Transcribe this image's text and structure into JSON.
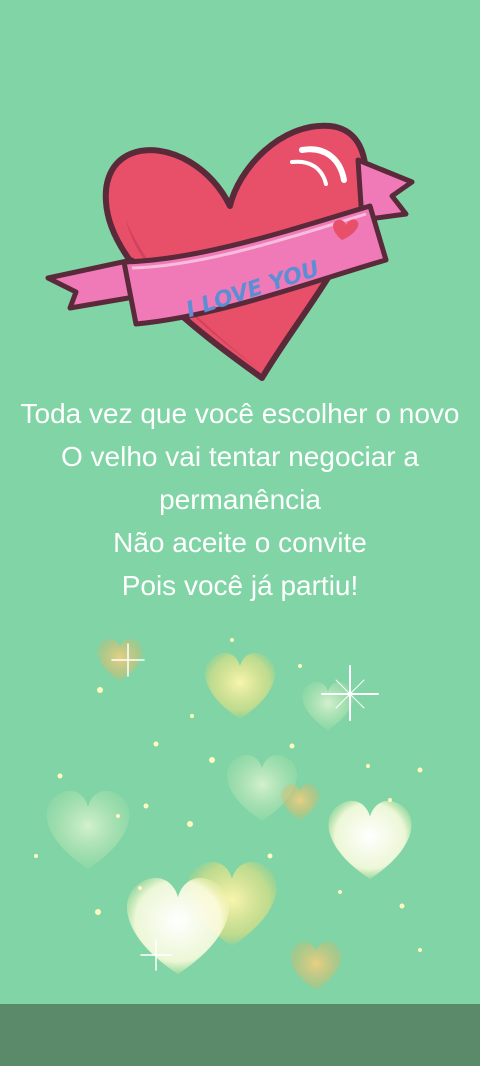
{
  "sticker": {
    "banner_text": "I LOVE YOU"
  },
  "message": {
    "lines": [
      "Toda vez que você escolher o novo",
      "O velho vai tentar negociar a permanência",
      "Não aceite o convite",
      "Pois você já partiu!"
    ]
  },
  "colors": {
    "background": "#80d4a5",
    "heart": "#e8506a",
    "banner": "#f07ab8",
    "text": "#ffffff",
    "nav_bar": "#5a8a6a"
  }
}
